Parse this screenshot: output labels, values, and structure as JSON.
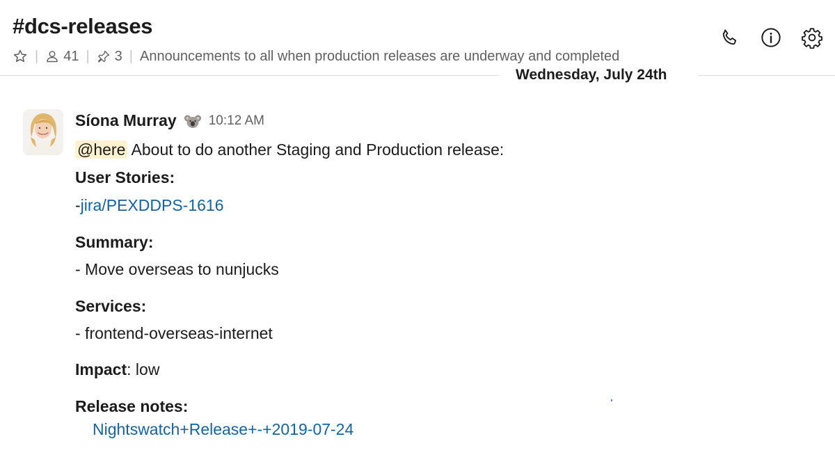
{
  "channel": {
    "name": "#dcs-releases",
    "members_count": "41",
    "pins_count": "3",
    "description": "Announcements to all when production releases are underway and completed"
  },
  "date_divider": "Wednesday, July 24th",
  "message": {
    "sender": "Síona Murray",
    "time": "10:12 AM",
    "mention": "@here",
    "intro": "About to do another Staging and Production release:",
    "user_stories_label": "User Stories:",
    "story_prefix": "-",
    "story_link": "jira/PEXDDPS-1616",
    "summary_label": "Summary:",
    "summary_item": "- Move overseas to nunjucks",
    "services_label": "Services:",
    "services_item": "- frontend-overseas-internet",
    "impact_label": "Impact",
    "impact_value": ": low",
    "release_notes_label": "Release notes:",
    "release_notes_link": "Nightswatch+Release+-+2019-07-24"
  },
  "icons": {
    "star": "star-icon",
    "members": "person-icon",
    "pins": "pin-icon",
    "call": "phone-icon",
    "info": "info-icon",
    "settings": "gear-icon",
    "status": "koala-emoji-icon"
  },
  "colors": {
    "link": "#1264a3",
    "mention_bg": "#fdf1cf",
    "muted": "#616061"
  }
}
